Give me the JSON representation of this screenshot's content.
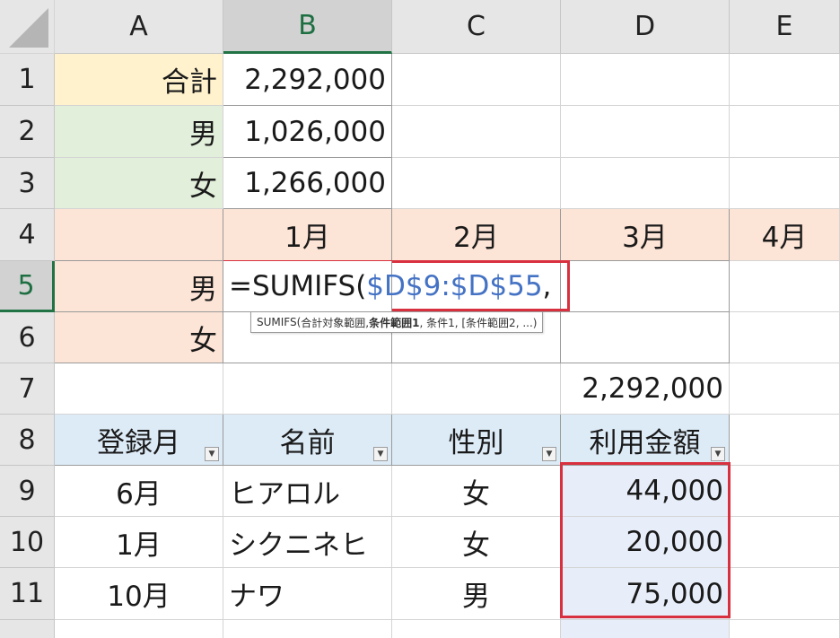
{
  "columns": [
    "A",
    "B",
    "C",
    "D",
    "E"
  ],
  "selected_column": "B",
  "selected_row": "5",
  "rows": [
    {
      "num": "1",
      "a": "合計",
      "b": "2,292,000",
      "c": "",
      "d": "",
      "e": ""
    },
    {
      "num": "2",
      "a": "男",
      "b": "1,026,000",
      "c": "",
      "d": "",
      "e": ""
    },
    {
      "num": "3",
      "a": "女",
      "b": "1,266,000",
      "c": "",
      "d": "",
      "e": ""
    },
    {
      "num": "4",
      "a": "",
      "b": "1月",
      "c": "2月",
      "d": "3月",
      "e": "4月"
    },
    {
      "num": "5",
      "a": "男",
      "b": "",
      "c": "",
      "d": "",
      "e": ""
    },
    {
      "num": "6",
      "a": "女",
      "b": "",
      "c": "",
      "d": "",
      "e": ""
    },
    {
      "num": "7",
      "a": "",
      "b": "",
      "c": "",
      "d": "2,292,000",
      "e": ""
    },
    {
      "num": "8",
      "a": "登録月",
      "b": "名前",
      "c": "性別",
      "d": "利用金額",
      "e": ""
    },
    {
      "num": "9",
      "a": "6月",
      "b": "ヒアロル",
      "c": "女",
      "d": "44,000",
      "e": ""
    },
    {
      "num": "10",
      "a": "1月",
      "b": "シクニネヒ",
      "c": "女",
      "d": "20,000",
      "e": ""
    },
    {
      "num": "11",
      "a": "10月",
      "b": "ナワ",
      "c": "男",
      "d": "75,000",
      "e": ""
    }
  ],
  "editing_formula": {
    "prefix": "=SUMIFS(",
    "range_ref": "$D$9:$D$55",
    "suffix": ","
  },
  "tooltip": {
    "func": "SUMIFS(",
    "arg1": "合計対象範囲, ",
    "arg2_bold": "条件範囲1",
    "rest": ", 条件1, [条件範囲2, ...)"
  },
  "filter_icon": "dropdown-arrow-icon",
  "colors": {
    "total_fill": "#fff2cc",
    "gender_fill": "#e2efda",
    "month_fill": "#fce4d6",
    "header_fill": "#ddebf7",
    "range_highlight": "#d9303f",
    "reference_text": "#4472c4"
  }
}
